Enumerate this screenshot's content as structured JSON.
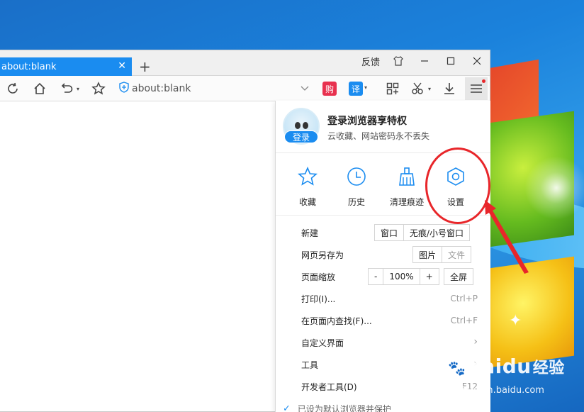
{
  "browser": {
    "tab_title": "about:blank",
    "new_tab_label": "+",
    "feedback_label": "反馈",
    "address": "about:blank"
  },
  "menu": {
    "account": {
      "title": "登录浏览器享特权",
      "subtitle": "云收藏、网站密码永不丢失",
      "login_label": "登录"
    },
    "quick": [
      {
        "label": "收藏",
        "icon": "star-icon"
      },
      {
        "label": "历史",
        "icon": "clock-icon"
      },
      {
        "label": "清理痕迹",
        "icon": "broom-icon"
      },
      {
        "label": "设置",
        "icon": "gear-icon"
      }
    ],
    "new": {
      "label": "新建",
      "window": "窗口",
      "incognito": "无痕/小号窗口"
    },
    "save_as": {
      "label": "网页另存为",
      "image": "图片",
      "file": "文件"
    },
    "zoom": {
      "label": "页面缩放",
      "minus": "-",
      "value": "100%",
      "plus": "+",
      "fullscreen": "全屏"
    },
    "print": {
      "label": "打印(I)...",
      "shortcut": "Ctrl+P"
    },
    "find": {
      "label": "在页面内查找(F)...",
      "shortcut": "Ctrl+F"
    },
    "customize": {
      "label": "自定义界面"
    },
    "tools": {
      "label": "工具"
    },
    "devtools": {
      "label": "开发者工具(D)",
      "shortcut": "F12"
    },
    "default_browser": {
      "label": "已设为默认浏览器并保护"
    }
  },
  "watermark": {
    "logo_text": "Baidu",
    "logo_cn": "经验",
    "url": "jingyan.baidu.com"
  },
  "colors": {
    "accent": "#1a8cf0",
    "annotation": "#e8262a",
    "buy_badge": "#e8314f"
  }
}
